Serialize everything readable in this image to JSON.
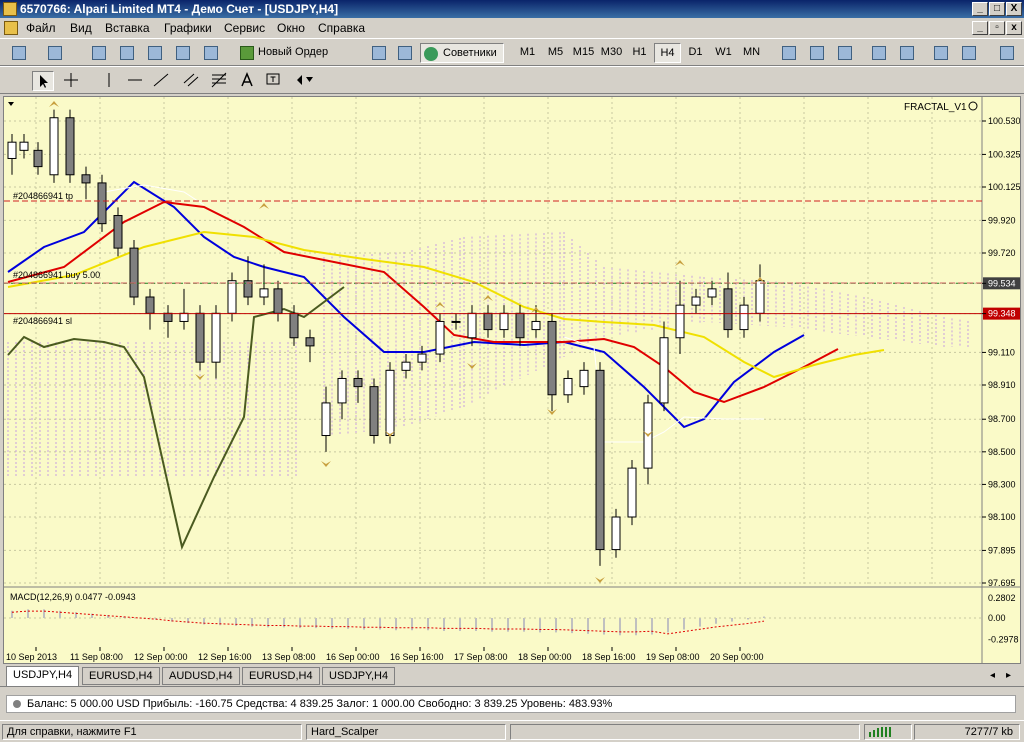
{
  "window": {
    "title": "6570766: Alpari Limited MT4 - Демо Счет - [USDJPY,H4]",
    "controls": [
      "_",
      "□",
      "X"
    ],
    "inner_controls": [
      "_",
      "▫",
      "x"
    ]
  },
  "menu": [
    "Файл",
    "Вид",
    "Вставка",
    "Графики",
    "Сервис",
    "Окно",
    "Справка"
  ],
  "toolbar": {
    "new_order": "Новый Ордер",
    "experts": "Советники",
    "timeframes": [
      "M1",
      "M5",
      "M15",
      "M30",
      "H1",
      "H4",
      "D1",
      "W1",
      "MN"
    ],
    "active_timeframe": "H4"
  },
  "chart": {
    "symbol_label": "FRACTAL_V1",
    "price_labels": [
      "100.530",
      "100.325",
      "100.125",
      "99.920",
      "99.720",
      "99.534",
      "99.348",
      "99.110",
      "98.910",
      "98.700",
      "98.500",
      "98.300",
      "98.100",
      "97.895",
      "97.695"
    ],
    "current_bid": "99.534",
    "order_line_price": "99.348",
    "order_labels": {
      "tp": "#204866941 tp",
      "buy": "#204866941 buy 5.00",
      "sl": "#204866941 sl"
    },
    "macd_label": "MACD(12,26,9) 0.0477 -0.0943",
    "macd_scale": [
      "0.2802",
      "0.00",
      "-0.2978"
    ],
    "time_labels": [
      "10 Sep 2013",
      "11 Sep 08:00",
      "12 Sep 00:00",
      "12 Sep 16:00",
      "13 Sep 08:00",
      "16 Sep 00:00",
      "16 Sep 16:00",
      "17 Sep 08:00",
      "18 Sep 00:00",
      "18 Sep 16:00",
      "19 Sep 08:00",
      "20 Sep 00:00"
    ],
    "colors": {
      "background": "#fafac8",
      "ma_fast": "#0000dd",
      "ma_mid": "#e00000",
      "ma_slow": "#f0e000",
      "bull_candle": "#ffffff",
      "bear_candle": "#808080",
      "fractal": "#c8a040",
      "tp_line": "#d02020",
      "sl_line": "#c00000"
    }
  },
  "tabs": [
    "USDJPY,H4",
    "EURUSD,H4",
    "AUDUSD,H4",
    "EURUSD,H4",
    "USDJPY,H4"
  ],
  "active_tab": 0,
  "terminal": {
    "summary": "Баланс: 5 000.00 USD  Прибыль: -160.75  Средства: 4 839.25  Залог: 1 000.00  Свободно: 3 839.25  Уровень: 483.93%"
  },
  "status": {
    "help": "Для справки, нажмите F1",
    "profile": "Hard_Scalper",
    "traffic": "7277/7 kb"
  }
}
